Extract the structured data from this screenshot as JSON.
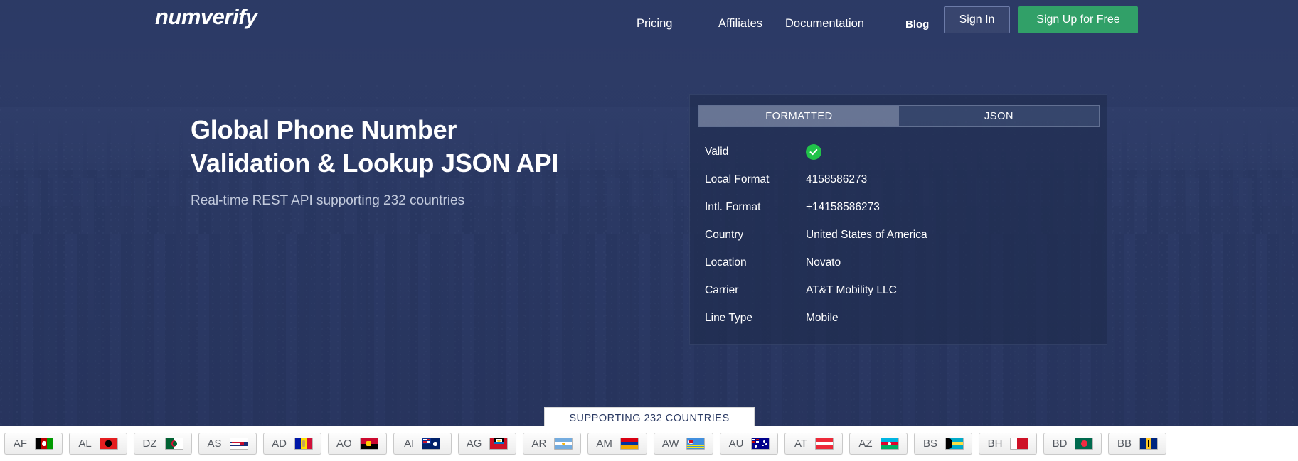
{
  "brand": {
    "logo": "numverify"
  },
  "nav": {
    "links": [
      {
        "label": "Pricing",
        "name": "nav-pricing"
      },
      {
        "label": "Affiliates",
        "name": "nav-affiliates"
      },
      {
        "label": "Documentation",
        "name": "nav-documentation"
      },
      {
        "label": "Blog",
        "name": "nav-blog"
      }
    ],
    "sign_in": "Sign In",
    "sign_up": "Sign Up for Free",
    "signup_color": "#31a068"
  },
  "hero": {
    "title_line1": "Global Phone Number",
    "title_line2": "Validation & Lookup JSON API",
    "subtitle": "Real-time REST API supporting 232 countries"
  },
  "panel": {
    "tabs": [
      {
        "label": "FORMATTED",
        "active": true
      },
      {
        "label": "JSON",
        "active": false
      }
    ],
    "rows": [
      {
        "key": "Valid",
        "value": "",
        "type": "check"
      },
      {
        "key": "Local Format",
        "value": "4158586273",
        "type": "text"
      },
      {
        "key": "Intl. Format",
        "value": "+14158586273",
        "type": "text"
      },
      {
        "key": "Country",
        "value": "United States of America",
        "type": "text"
      },
      {
        "key": "Location",
        "value": "Novato",
        "type": "text"
      },
      {
        "key": "Carrier",
        "value": "AT&T Mobility LLC",
        "type": "text"
      },
      {
        "key": "Line Type",
        "value": "Mobile",
        "type": "text"
      }
    ],
    "check_color": "#21c24a"
  },
  "supporting_banner": "SUPPORTING 232 COUNTRIES",
  "countries": [
    {
      "code": "AF",
      "name": "Afghanistan"
    },
    {
      "code": "AL",
      "name": "Albania"
    },
    {
      "code": "DZ",
      "name": "Algeria"
    },
    {
      "code": "AS",
      "name": "American Samoa"
    },
    {
      "code": "AD",
      "name": "Andorra"
    },
    {
      "code": "AO",
      "name": "Angola"
    },
    {
      "code": "AI",
      "name": "Anguilla"
    },
    {
      "code": "AG",
      "name": "Antigua and Barbuda"
    },
    {
      "code": "AR",
      "name": "Argentina"
    },
    {
      "code": "AM",
      "name": "Armenia"
    },
    {
      "code": "AW",
      "name": "Aruba"
    },
    {
      "code": "AU",
      "name": "Australia"
    },
    {
      "code": "AT",
      "name": "Austria"
    },
    {
      "code": "AZ",
      "name": "Azerbaijan"
    },
    {
      "code": "BS",
      "name": "Bahamas"
    },
    {
      "code": "BH",
      "name": "Bahrain"
    },
    {
      "code": "BD",
      "name": "Bangladesh"
    },
    {
      "code": "BB",
      "name": "Barbados"
    }
  ]
}
